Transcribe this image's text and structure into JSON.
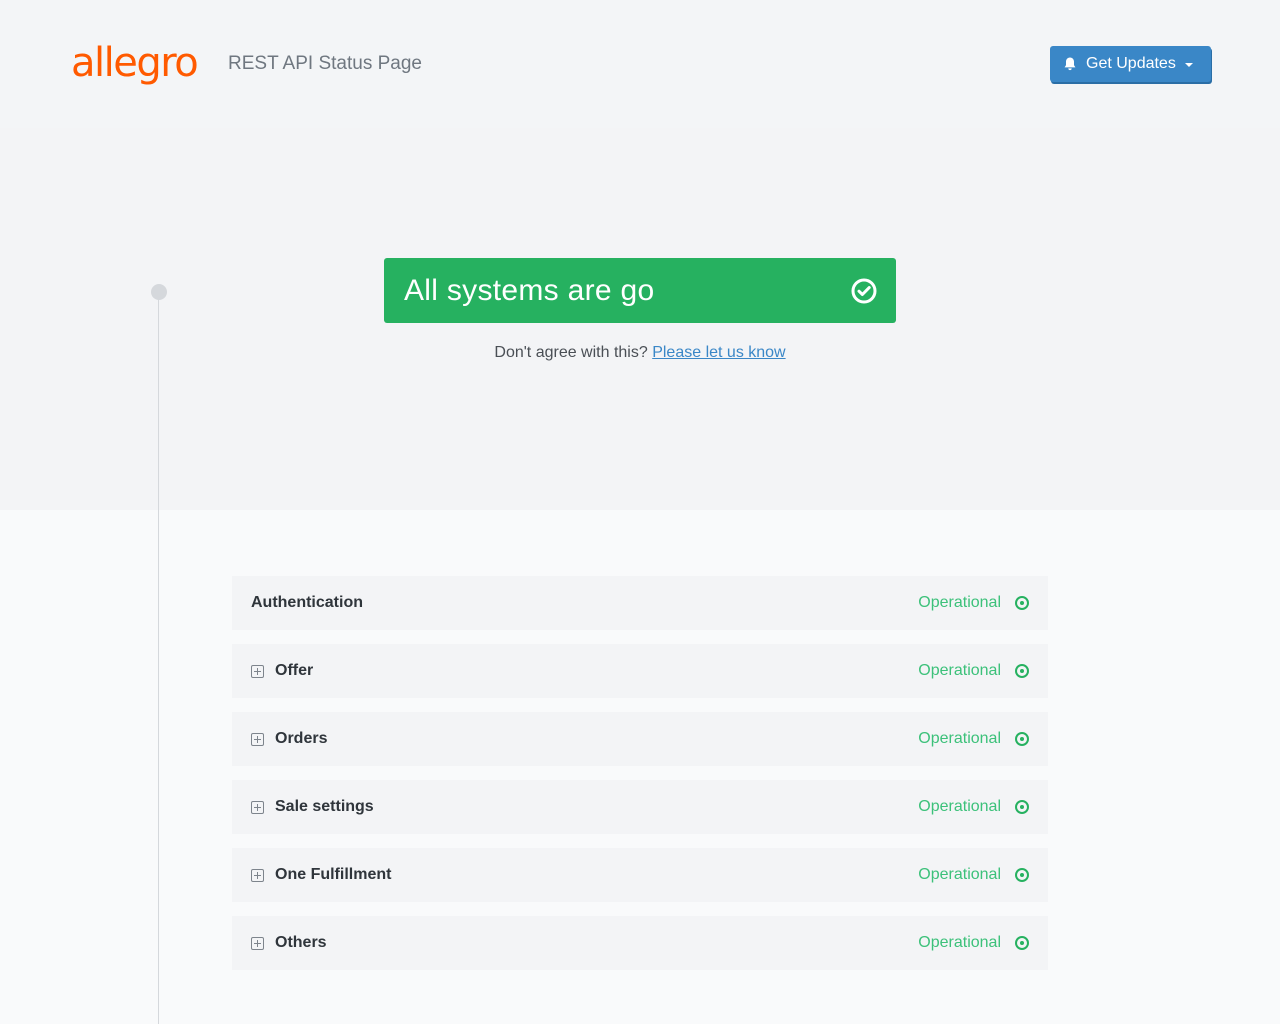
{
  "header": {
    "logo_text": "allegro",
    "title": "REST API Status Page",
    "get_updates_label": "Get Updates",
    "button_color": "#3a87c7",
    "logo_color": "#ff5a00"
  },
  "hero": {
    "status_text": "All systems are go",
    "status_color": "#26b160",
    "disagree_text": "Don't agree with this?",
    "disagree_link": "Please let us know"
  },
  "components": [
    {
      "name": "Authentication",
      "status": "Operational",
      "expandable": false
    },
    {
      "name": "Offer",
      "status": "Operational",
      "expandable": true
    },
    {
      "name": "Orders",
      "status": "Operational",
      "expandable": true
    },
    {
      "name": "Sale settings",
      "status": "Operational",
      "expandable": true
    },
    {
      "name": "One Fulfillment",
      "status": "Operational",
      "expandable": true
    },
    {
      "name": "Others",
      "status": "Operational",
      "expandable": true
    }
  ],
  "icons": {
    "bell": "bell-icon",
    "check": "check-circle-icon",
    "expand": "plus-square-icon",
    "operational": "operational-dot-icon"
  }
}
